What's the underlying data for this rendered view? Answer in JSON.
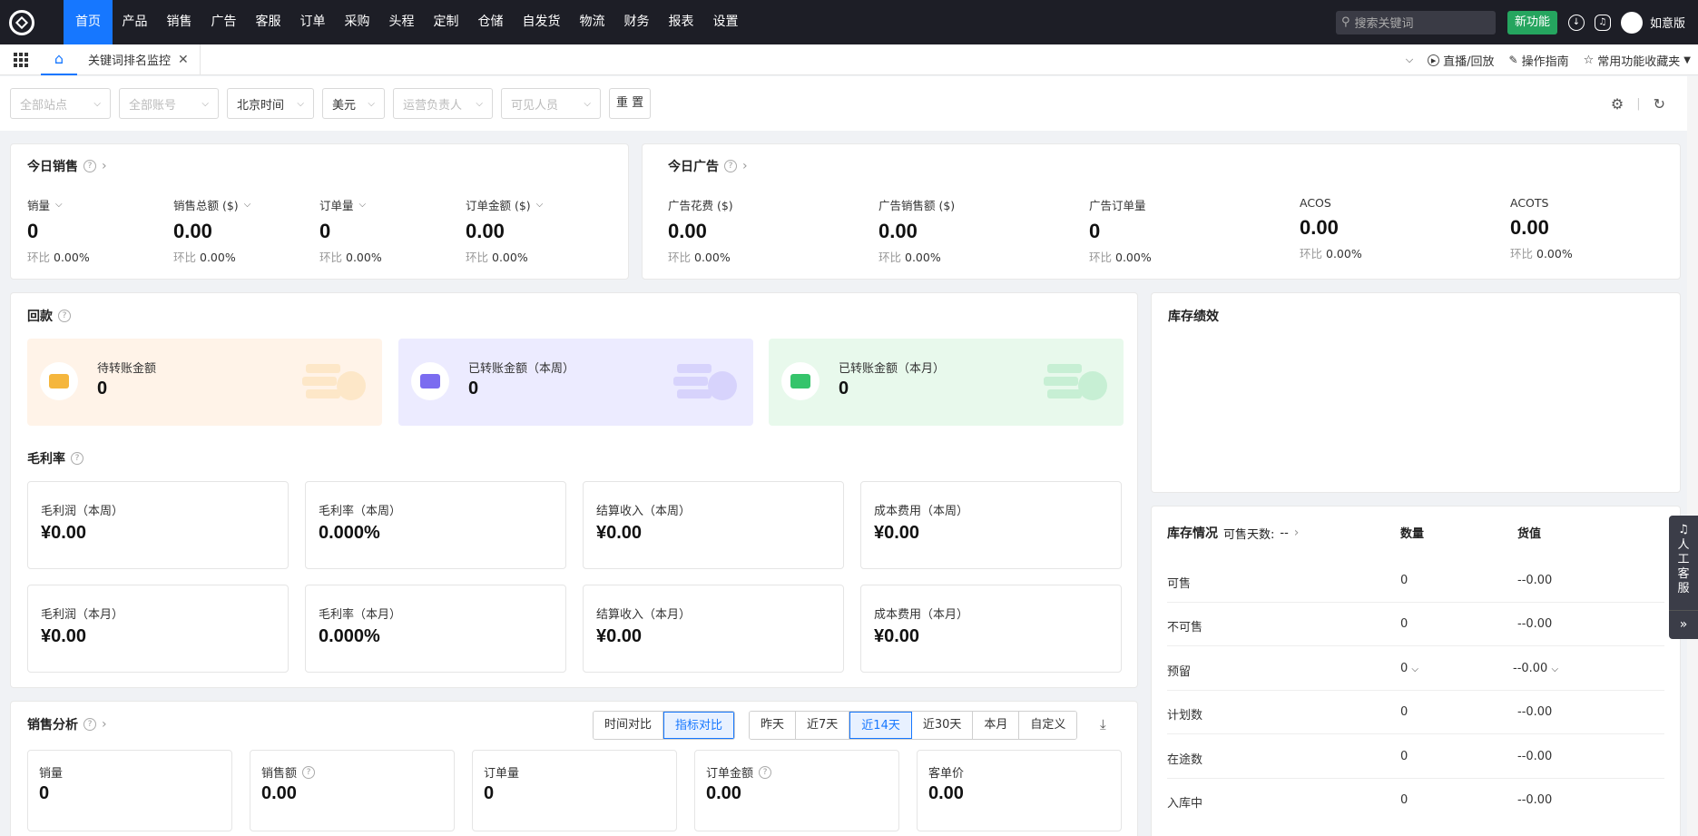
{
  "nav": {
    "items": [
      "首页",
      "产品",
      "销售",
      "广告",
      "客服",
      "订单",
      "采购",
      "头程",
      "定制",
      "仓储",
      "自发货",
      "物流",
      "财务",
      "报表",
      "设置"
    ],
    "search_placeholder": "搜索关键词",
    "new_feature": "新功能",
    "user_name": "如意版"
  },
  "tabs": {
    "page_tab": "关键词排名监控",
    "close": "✕",
    "live": "直播/回放",
    "guide": "操作指南",
    "favorites": "常用功能收藏夹"
  },
  "filters": {
    "site": "全部站点",
    "account": "全部账号",
    "timezone": "北京时间",
    "currency": "美元",
    "operator": "运营负责人",
    "visible": "可见人员",
    "reset": "重 置"
  },
  "today_sales": {
    "title": "今日销售",
    "ratio_label": "环比",
    "metrics": [
      {
        "label": "销量",
        "value": "0",
        "ratio": "0.00%"
      },
      {
        "label": "销售总额 ($)",
        "value": "0.00",
        "ratio": "0.00%"
      },
      {
        "label": "订单量",
        "value": "0",
        "ratio": "0.00%"
      },
      {
        "label": "订单金额 ($)",
        "value": "0.00",
        "ratio": "0.00%"
      }
    ]
  },
  "today_ads": {
    "title": "今日广告",
    "metrics": [
      {
        "label": "广告花费 ($)",
        "value": "0.00",
        "ratio": "0.00%"
      },
      {
        "label": "广告销售额 ($)",
        "value": "0.00",
        "ratio": "0.00%"
      },
      {
        "label": "广告订单量",
        "value": "0",
        "ratio": "0.00%"
      },
      {
        "label": "ACOS",
        "value": "0.00",
        "ratio": "0.00%"
      },
      {
        "label": "ACOTS",
        "value": "0.00",
        "ratio": "0.00%"
      }
    ]
  },
  "refund": {
    "title": "回款",
    "boxes": [
      {
        "label": "待转账金额",
        "value": "0",
        "bg": "#fff3e8",
        "accent": "#f5b63d"
      },
      {
        "label": "已转账金额（本周）",
        "value": "0",
        "bg": "#ecebff",
        "accent": "#7b6cf0"
      },
      {
        "label": "已转账金额（本月）",
        "value": "0",
        "bg": "#e8f9ec",
        "accent": "#35c46b"
      }
    ]
  },
  "gross": {
    "title": "毛利率",
    "boxes": [
      {
        "label": "毛利润（本周）",
        "value": "¥0.00"
      },
      {
        "label": "毛利率（本周）",
        "value": "0.000%"
      },
      {
        "label": "结算收入（本周）",
        "value": "¥0.00"
      },
      {
        "label": "成本费用（本周）",
        "value": "¥0.00"
      },
      {
        "label": "毛利润（本月）",
        "value": "¥0.00"
      },
      {
        "label": "毛利率（本月）",
        "value": "0.000%"
      },
      {
        "label": "结算收入（本月）",
        "value": "¥0.00"
      },
      {
        "label": "成本费用（本月）",
        "value": "¥0.00"
      }
    ]
  },
  "analysis": {
    "title": "销售分析",
    "mode": [
      "时间对比",
      "指标对比"
    ],
    "ranges": [
      "昨天",
      "近7天",
      "近14天",
      "近30天",
      "本月",
      "自定义"
    ],
    "boxes": [
      {
        "label": "销量",
        "value": "0"
      },
      {
        "label": "销售额",
        "value": "0.00"
      },
      {
        "label": "订单量",
        "value": "0"
      },
      {
        "label": "订单金额",
        "value": "0.00"
      },
      {
        "label": "客单价",
        "value": "0.00"
      }
    ]
  },
  "inventory_perf": {
    "title": "库存绩效"
  },
  "inventory": {
    "title": "库存情况",
    "days_label": "可售天数:",
    "days_value": "--",
    "col_qty": "数量",
    "col_value": "货值",
    "rows": [
      {
        "name": "可售",
        "qty": "0",
        "value": "--0.00"
      },
      {
        "name": "不可售",
        "qty": "0",
        "value": "--0.00"
      },
      {
        "name": "预留",
        "qty": "0",
        "value": "--0.00"
      },
      {
        "name": "计划数",
        "qty": "0",
        "value": "--0.00"
      },
      {
        "name": "在途数",
        "qty": "0",
        "value": "--0.00"
      },
      {
        "name": "入库中",
        "qty": "0",
        "value": "--0.00"
      }
    ]
  },
  "cs": {
    "label": "人工客服"
  }
}
